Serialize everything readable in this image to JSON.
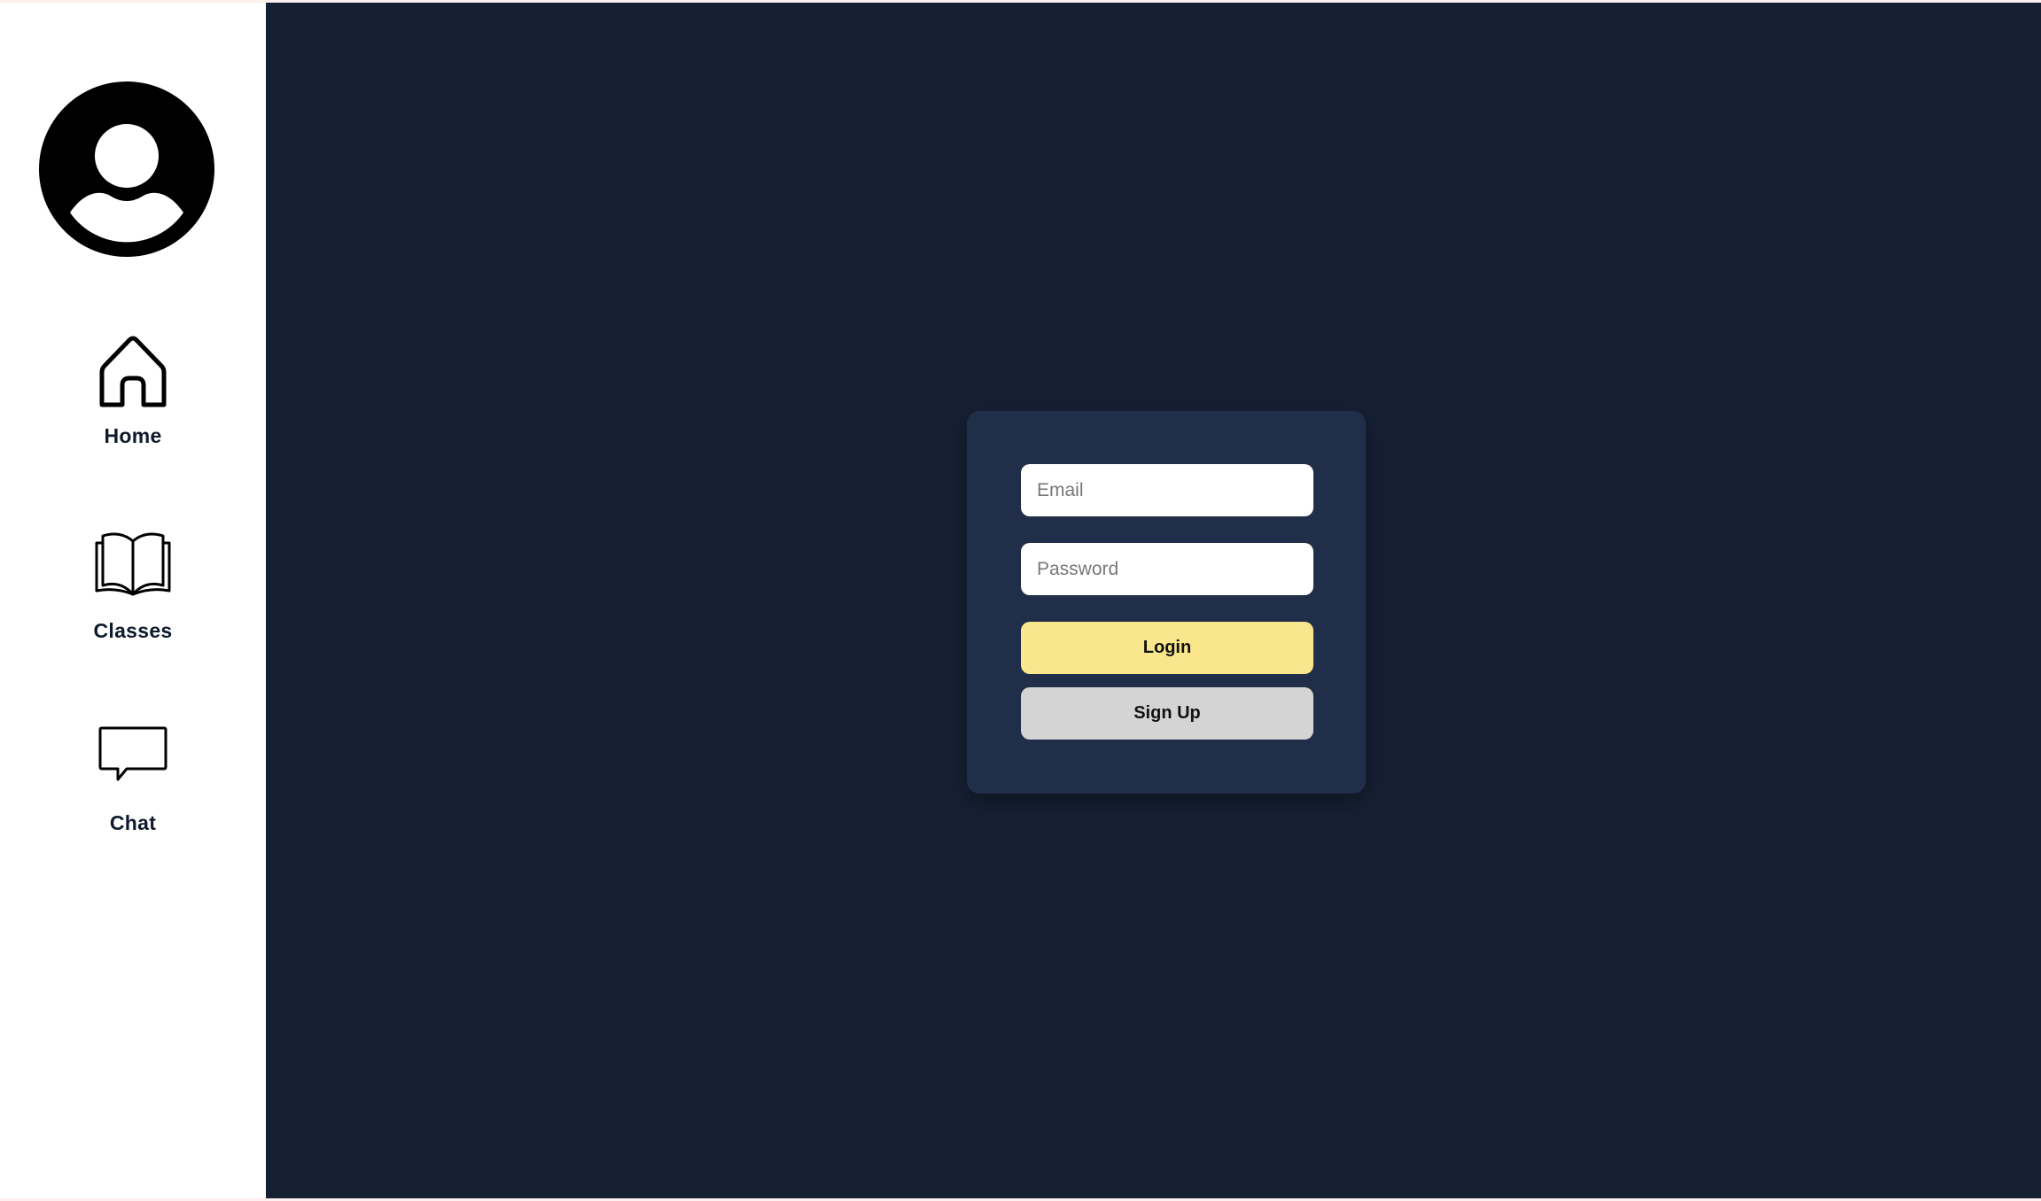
{
  "sidebar": {
    "avatar_icon": "user-avatar-icon",
    "items": [
      {
        "label": "Home",
        "icon": "house-icon"
      },
      {
        "label": "Classes",
        "icon": "open-book-icon"
      },
      {
        "label": "Chat",
        "icon": "speech-bubble-icon"
      }
    ]
  },
  "login": {
    "email_placeholder": "Email",
    "email_value": "",
    "password_placeholder": "Password",
    "password_value": "",
    "login_label": "Login",
    "signup_label": "Sign Up"
  },
  "colors": {
    "main_background": "#152033",
    "card_background": "#212e49",
    "login_button": "#fae68c",
    "signup_button": "#d4d4d4",
    "sidebar_background": "#ffffff",
    "nav_text": "#0f1a2c"
  }
}
